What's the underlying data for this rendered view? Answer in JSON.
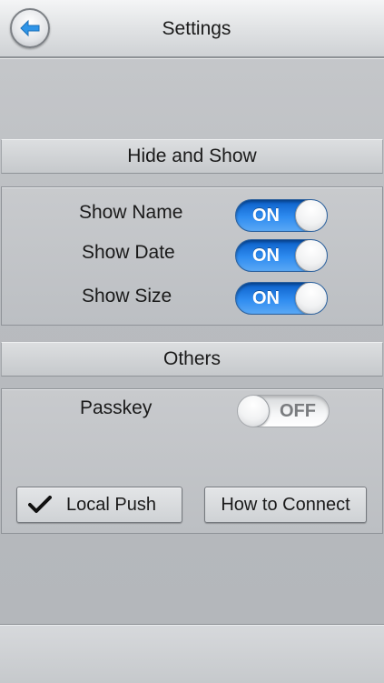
{
  "navbar": {
    "title": "Settings",
    "back_icon": "back-arrow-icon"
  },
  "sections": {
    "hide_and_show": {
      "header": "Hide and Show",
      "rows": [
        {
          "label": "Show Name",
          "state": "ON"
        },
        {
          "label": "Show Date",
          "state": "ON"
        },
        {
          "label": "Show Size",
          "state": "ON"
        }
      ]
    },
    "others": {
      "header": "Others",
      "passkey": {
        "label": "Passkey",
        "state": "OFF"
      },
      "local_push": {
        "label": "Local Push",
        "checked": true,
        "icon": "checkmark-icon"
      },
      "how_to_connect": {
        "label": "How to Connect"
      }
    }
  },
  "colors": {
    "switch_on": "#2f8cf0",
    "switch_off": "#f6f7f8",
    "back_arrow": "#2f95e8"
  }
}
